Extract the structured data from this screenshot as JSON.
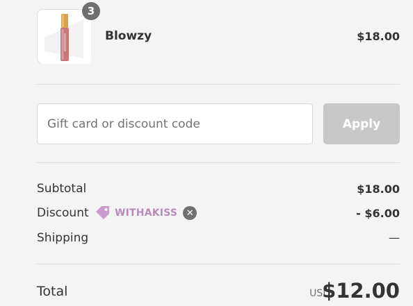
{
  "line_item": {
    "quantity": "3",
    "name": "Blowzy",
    "price": "$18.00"
  },
  "discount_form": {
    "placeholder": "Gift card or discount code",
    "apply_label": "Apply"
  },
  "totals": {
    "subtotal_label": "Subtotal",
    "subtotal_value": "$18.00",
    "discount_label": "Discount",
    "discount_code": "WITHAKISS",
    "discount_value": "- $6.00",
    "shipping_label": "Shipping",
    "shipping_value": "—",
    "total_label": "Total",
    "currency": "USD",
    "total_value": "$12.00"
  },
  "colors": {
    "background": "#f4f4f4",
    "apply_disabled": "#c8c8c8",
    "discount_tag": "#b78bbb",
    "badge": "#6f6f6f"
  }
}
